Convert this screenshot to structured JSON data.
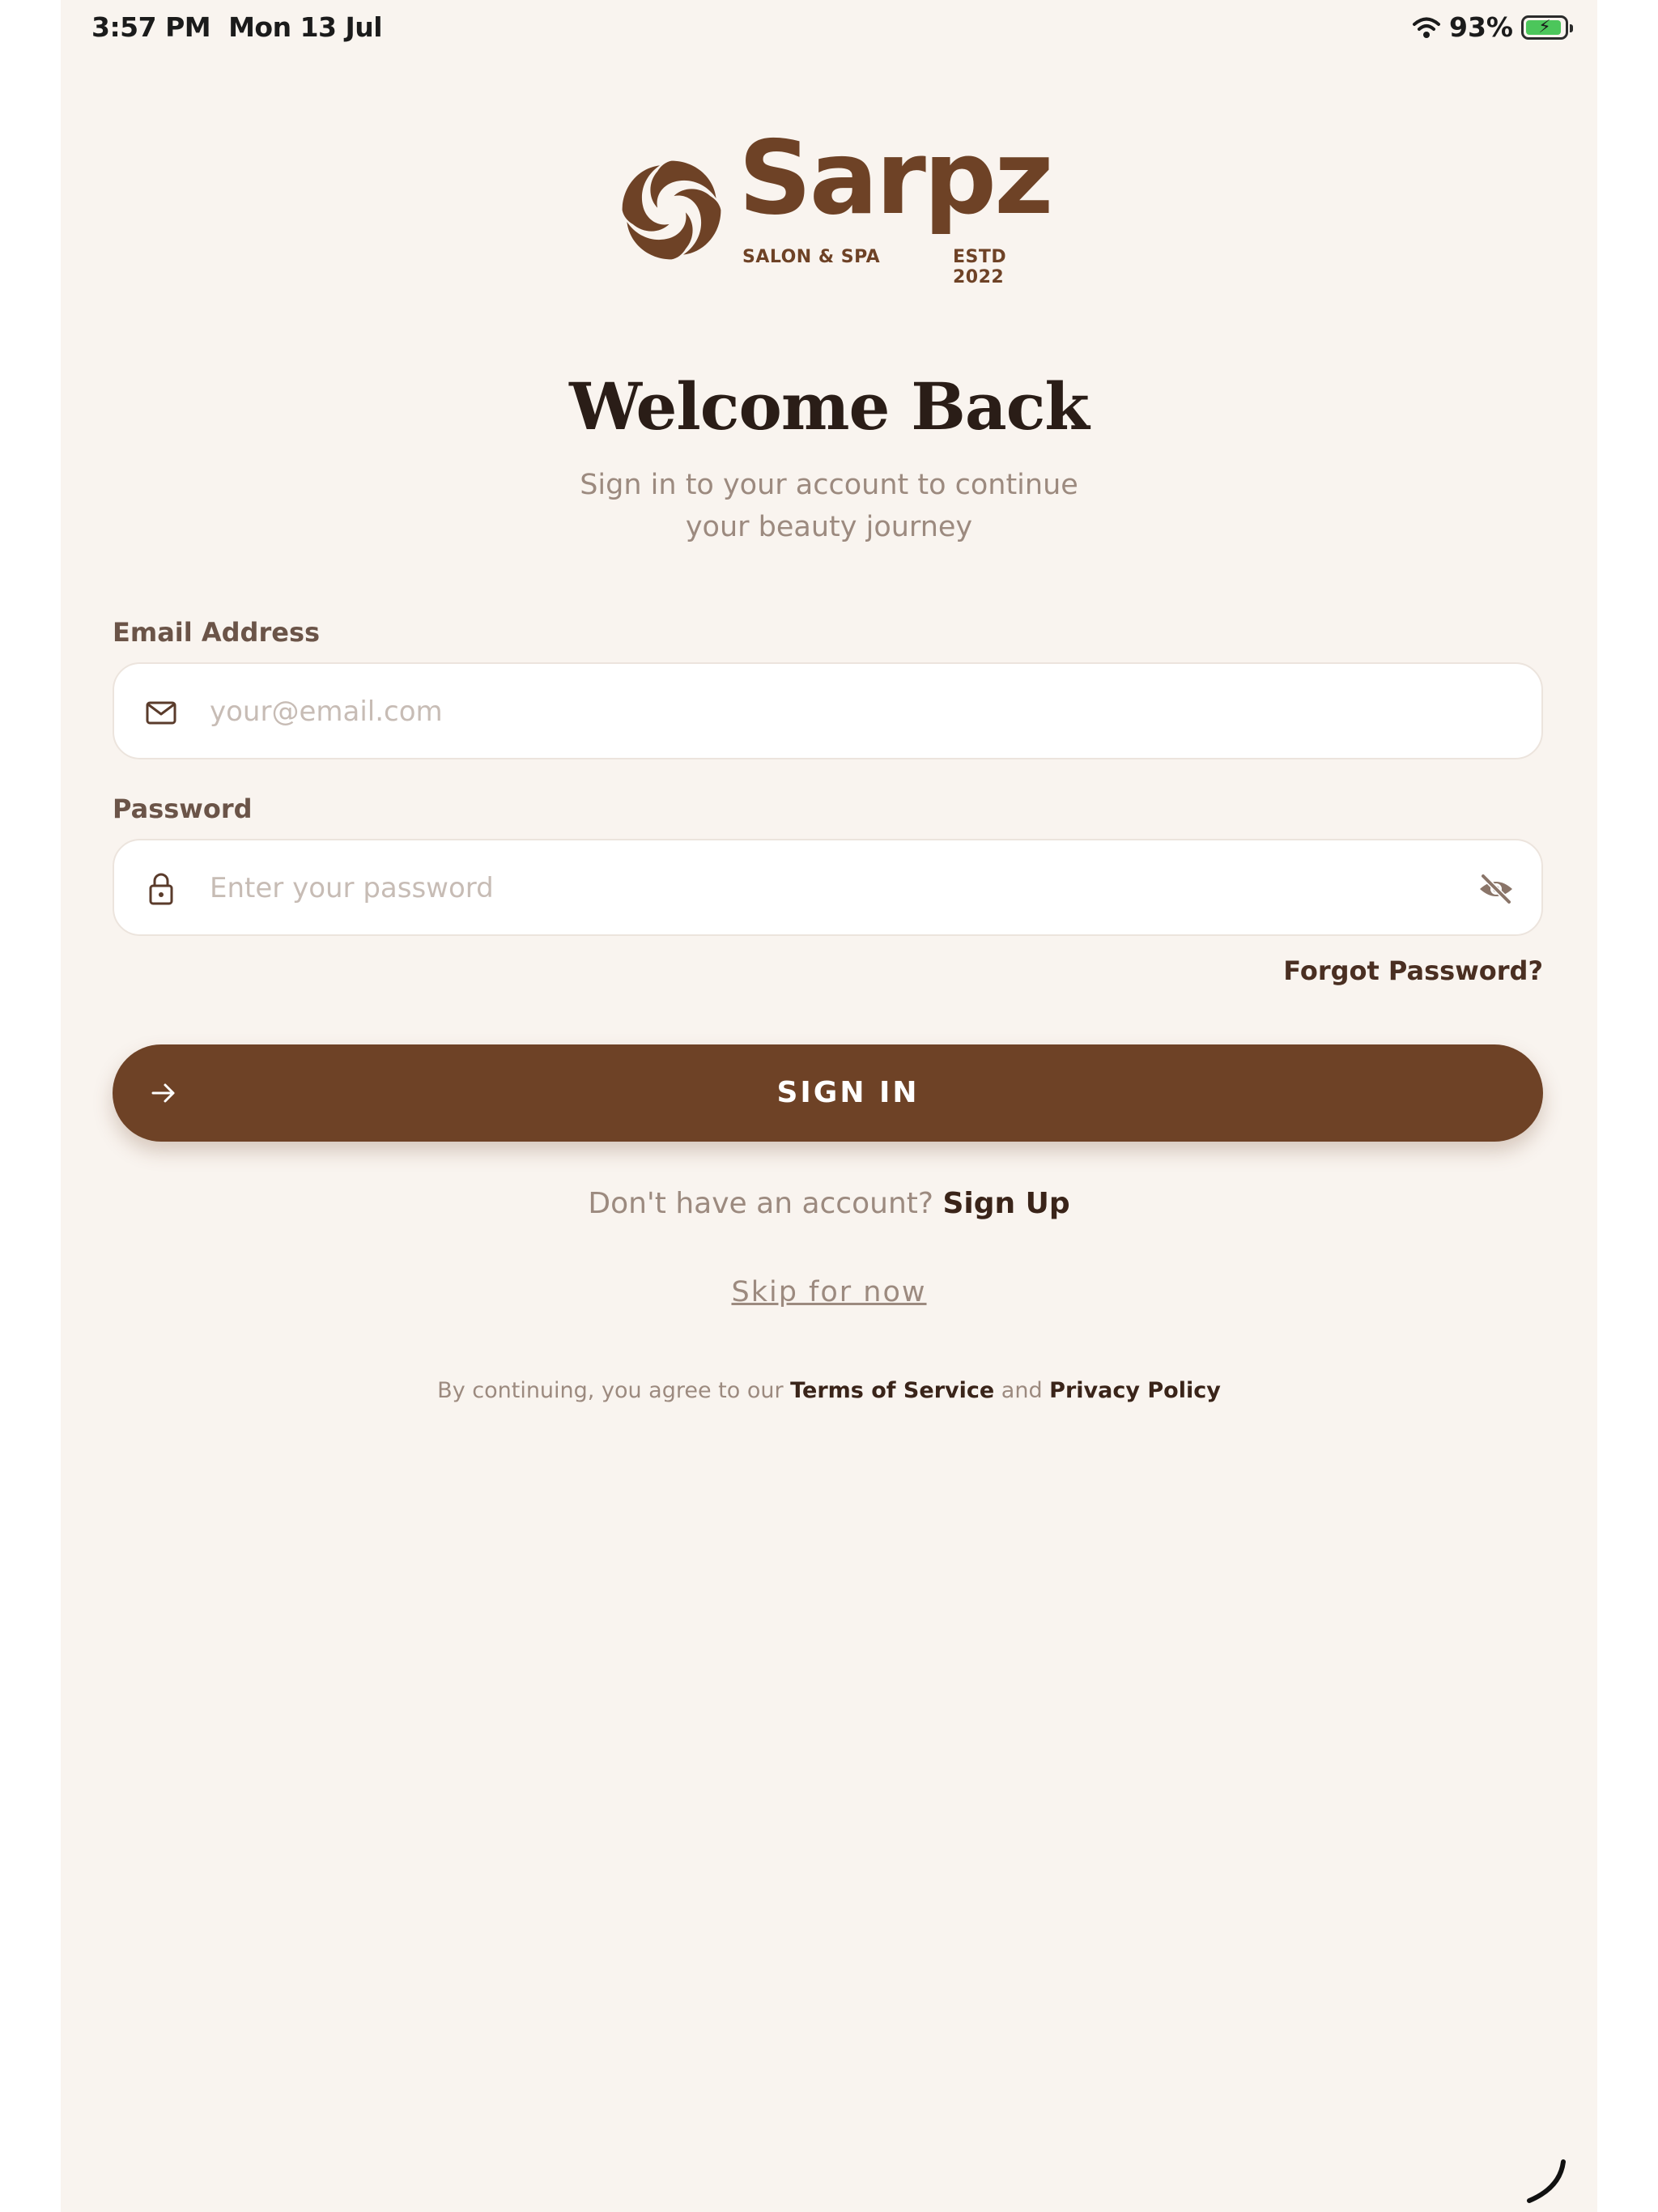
{
  "status_bar": {
    "time": "3:57 PM",
    "date": "Mon 13 Jul",
    "battery": "93%",
    "battery_level": 0.93
  },
  "brand": {
    "name": "Sarpz",
    "tag_left": "SALON & SPA",
    "tag_right": "ESTD 2022",
    "color": "#6e4226"
  },
  "header": {
    "title": "Welcome Back",
    "subtitle_line1": "Sign in to your account to continue",
    "subtitle_line2": "your beauty journey"
  },
  "form": {
    "email_label": "Email Address",
    "email_placeholder": "your@email.com",
    "password_label": "Password",
    "password_placeholder": "Enter your password",
    "forgot_label": "Forgot Password?",
    "submit_label": "SIGN IN"
  },
  "footer": {
    "no_account": "Don't have an account?",
    "signup_label": "Sign Up",
    "skip_label": "Skip for now",
    "legal_prefix": "By continuing, you agree to our",
    "terms_label": "Terms of Service",
    "legal_and": "and",
    "privacy_label": "Privacy Policy"
  },
  "icons": {
    "email": "mail-icon",
    "password": "lock-icon",
    "toggle": "eye-off-icon",
    "submit": "arrow-right-icon",
    "wifi": "wifi-icon",
    "battery": "battery-charging-icon"
  },
  "colors": {
    "background": "#f9f4ef",
    "accent": "#6e4226",
    "muted_text": "#9c8a7f"
  }
}
